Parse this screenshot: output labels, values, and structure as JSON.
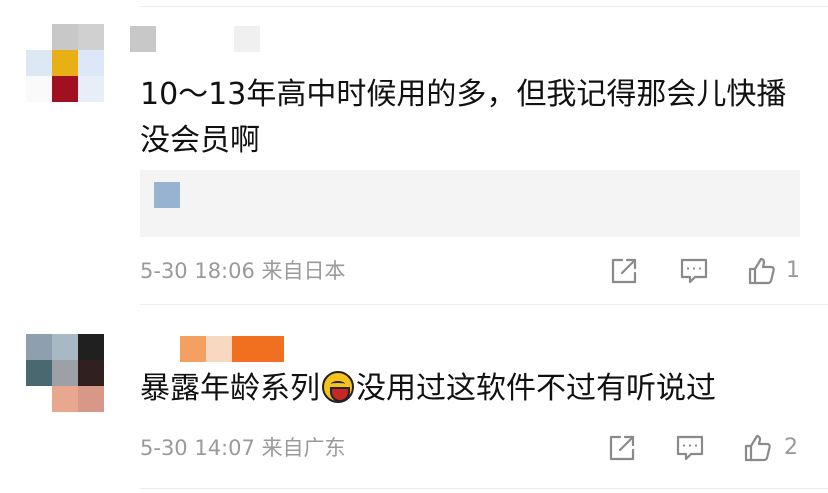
{
  "comments": [
    {
      "author": "",
      "text": "10～13年高中时候用的多，但我记得那会儿快播没会员啊",
      "time": "5-30 18:06",
      "location": "来自日本",
      "likes": "1",
      "avatar_colors": [
        "#ffffff",
        "#c8c8c8",
        "#d0d0d0",
        "#dce8f4",
        "#e8b014",
        "#dce8f8",
        "#fafafa",
        "#a01020",
        "#e8eef8"
      ],
      "name_colors": [
        "#c8c8c8",
        "#ffffff",
        "#f0f0f0"
      ]
    },
    {
      "author": "",
      "text_before": "暴露年龄系列",
      "emoji": "grinning-face-emoji",
      "text_after": "没用过这软件不过有听说过",
      "time": "5-30 14:07",
      "location": "来自广东",
      "likes": "2",
      "avatar_colors": [
        "#8ea0b0",
        "#a8b8c4",
        "#202020",
        "#4a6870",
        "#9ea0a8",
        "#302020",
        "#ffffff",
        "#e8a890",
        "#d89888"
      ],
      "name_colors": [
        "#f4a060",
        "#f8d8c0",
        "#f07020"
      ]
    }
  ],
  "quote_block_color": "#98b2d1",
  "icons": [
    "share-icon",
    "comment-icon",
    "like-icon"
  ]
}
